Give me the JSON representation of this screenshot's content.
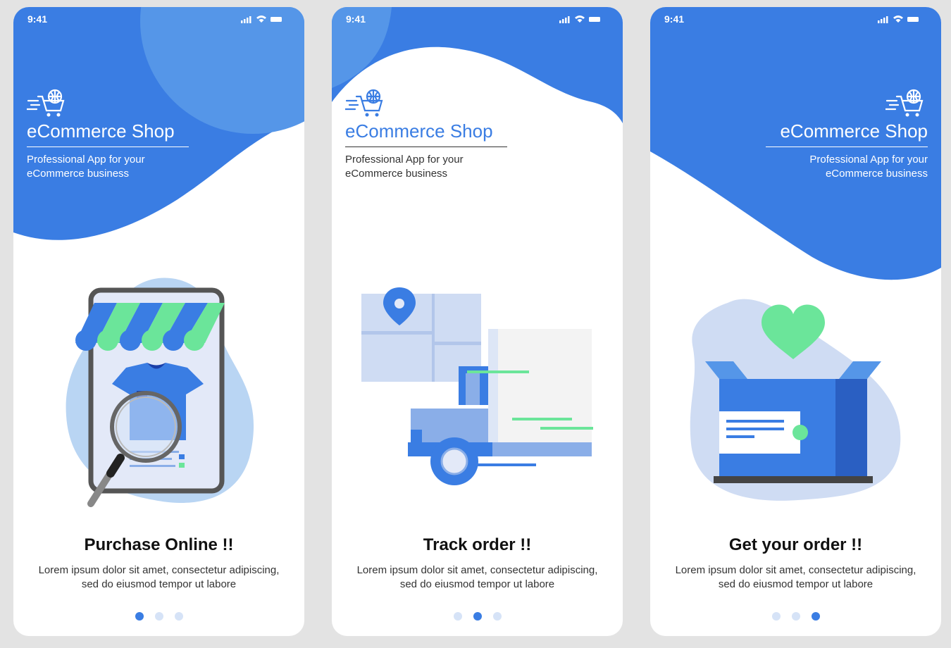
{
  "colors": {
    "accent": "#3a7de3",
    "light_accent": "#5596e8",
    "green": "#6be59a",
    "pale_blue": "#cfdcf3",
    "background": "#e3e3e3"
  },
  "screens": [
    {
      "status_time": "9:41",
      "brand_title": "eCommerce Shop",
      "brand_subtitle_line1": "Professional App for your",
      "brand_subtitle_line2": "eCommerce business",
      "heading": "Purchase Online !!",
      "description_line1": "Lorem ipsum dolor sit amet, consectetur adipiscing,",
      "description_line2": "sed do eiusmod tempor ut labore",
      "illustration_icon": "shop-magnifier-icon",
      "active_page": 1,
      "page_count": 3
    },
    {
      "status_time": "9:41",
      "brand_title": "eCommerce Shop",
      "brand_subtitle_line1": "Professional App for your",
      "brand_subtitle_line2": "eCommerce business",
      "heading": "Track order !!",
      "description_line1": "Lorem ipsum dolor sit amet, consectetur adipiscing,",
      "description_line2": "sed do eiusmod tempor ut labore",
      "illustration_icon": "delivery-truck-icon",
      "active_page": 2,
      "page_count": 3
    },
    {
      "status_time": "9:41",
      "brand_title": "eCommerce Shop",
      "brand_subtitle_line1": "Professional App for your",
      "brand_subtitle_line2": "eCommerce business",
      "heading": "Get your order !!",
      "description_line1": "Lorem ipsum dolor sit amet, consectetur adipiscing,",
      "description_line2": "sed do eiusmod tempor ut labore",
      "illustration_icon": "open-box-heart-icon",
      "active_page": 3,
      "page_count": 3
    }
  ]
}
